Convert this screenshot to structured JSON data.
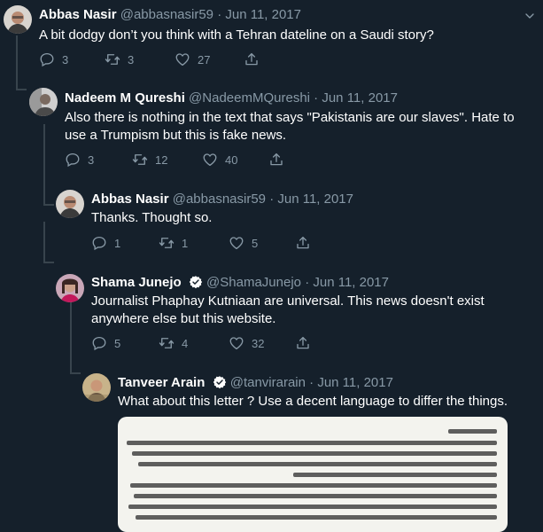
{
  "tweets": [
    {
      "name": "Abbas Nasir",
      "handle": "@abbasnasir59",
      "date": "Jun 11, 2017",
      "text": "A bit dodgy don’t you think with a Tehran dateline on a Saudi story?",
      "replies": "3",
      "retweets": "3",
      "likes": "27"
    },
    {
      "name": "Nadeem M Qureshi",
      "handle": "@NadeemMQureshi",
      "date": "Jun 11, 2017",
      "text_line1": "Also there is nothing in the text that says \"Pakistanis are our slaves\". Hate to",
      "text_line2": "use a Trumpism but this is fake news.",
      "replies": "3",
      "retweets": "12",
      "likes": "40"
    },
    {
      "name": "Abbas Nasir",
      "handle": "@abbasnasir59",
      "date": "Jun 11, 2017",
      "text": "Thanks. Thought so.",
      "replies": "1",
      "retweets": "1",
      "likes": "5"
    },
    {
      "name": "Shama Junejo",
      "handle": "@ShamaJunejo",
      "date": "Jun 11, 2017",
      "text_line1": "Journalist Phaphay Kutniaan are universal. This news doesn't exist",
      "text_line2": "anywhere else but this website.",
      "replies": "5",
      "retweets": "4",
      "likes": "32"
    },
    {
      "name": "Tanveer Arain",
      "handle": "@tanvirarain",
      "date": "Jun 11, 2017",
      "text": "What about this letter ? Use a decent language to differ the things."
    }
  ],
  "separator": "·",
  "colors": {
    "background": "#15202b",
    "muted": "#8899a6",
    "verified": "#ffffff",
    "thread_line": "#38444d"
  },
  "icons": [
    "reply-icon",
    "retweet-icon",
    "like-icon",
    "share-icon",
    "caret-down-icon",
    "verified-badge-icon"
  ]
}
